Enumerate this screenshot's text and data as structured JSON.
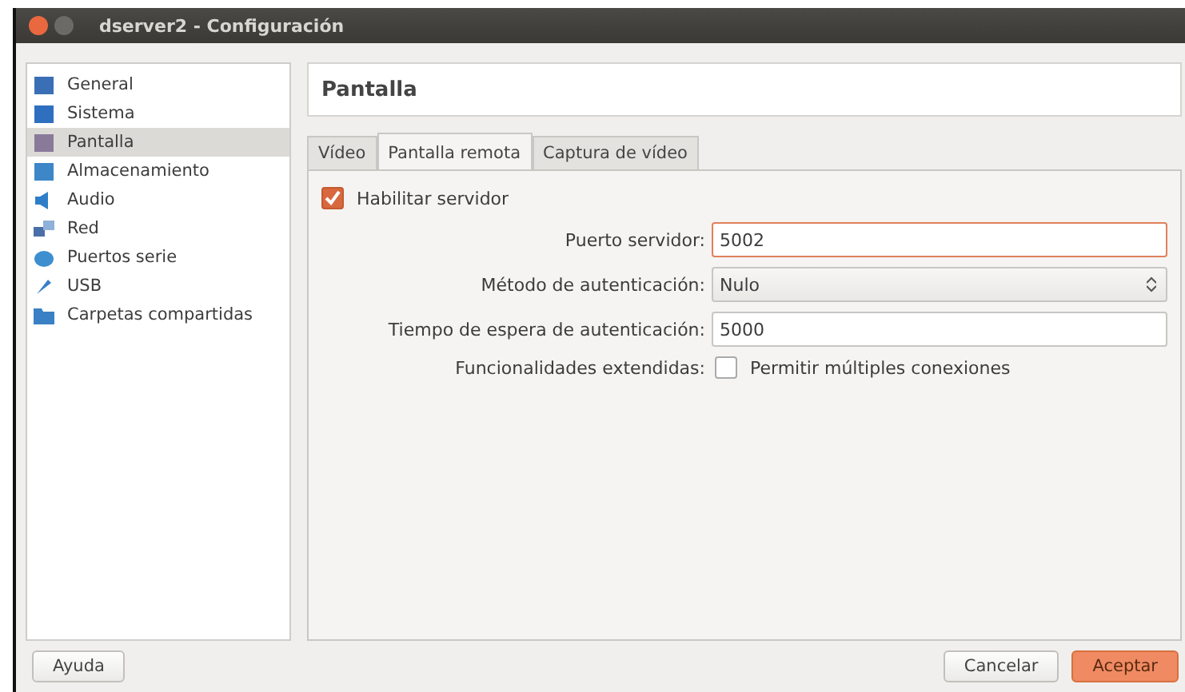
{
  "window": {
    "title": "dserver2 - Configuración"
  },
  "sidebar": {
    "items": [
      {
        "label": "General",
        "kind": "monitor",
        "selected": false
      },
      {
        "label": "Sistema",
        "kind": "chip",
        "selected": false
      },
      {
        "label": "Pantalla",
        "kind": "display",
        "selected": true
      },
      {
        "label": "Almacenamiento",
        "kind": "disk",
        "selected": false
      },
      {
        "label": "Audio",
        "kind": "speaker",
        "selected": false
      },
      {
        "label": "Red",
        "kind": "network",
        "selected": false
      },
      {
        "label": "Puertos serie",
        "kind": "serial",
        "selected": false
      },
      {
        "label": "USB",
        "kind": "usb",
        "selected": false
      },
      {
        "label": "Carpetas compartidas",
        "kind": "folder",
        "selected": false
      }
    ]
  },
  "page_title": "Pantalla",
  "tabs": [
    {
      "label": "Vídeo",
      "selected": false
    },
    {
      "label": "Pantalla remota",
      "selected": true
    },
    {
      "label": "Captura de vídeo",
      "selected": false
    }
  ],
  "enable_server": {
    "label": "Habilitar servidor",
    "checked": true
  },
  "fields": [
    {
      "kind": "text",
      "label": "Puerto servidor:",
      "value": "5002",
      "focused": true
    },
    {
      "kind": "select",
      "label": "Método de autenticación:",
      "value": "Nulo"
    },
    {
      "kind": "text",
      "label": "Tiempo de espera de autenticación:",
      "value": "5000",
      "focused": false
    },
    {
      "kind": "checkbox",
      "label": "Funcionalidades extendidas:",
      "option": "Permitir múltiples conexiones",
      "checked": false
    }
  ],
  "buttons": [
    {
      "label": "Ayuda",
      "kind": "normal"
    },
    {
      "label": "Cancelar",
      "kind": "normal"
    },
    {
      "label": "Aceptar",
      "kind": "default"
    }
  ]
}
